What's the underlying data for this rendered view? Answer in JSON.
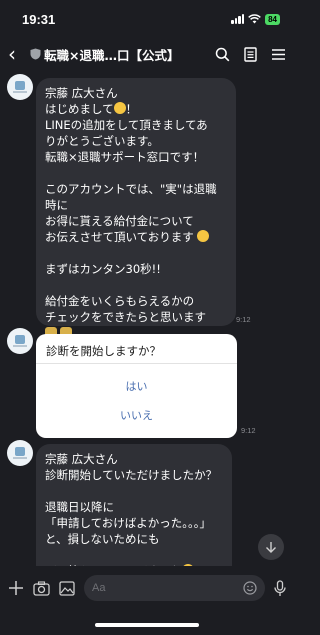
{
  "status_bar": {
    "time": "19:31",
    "battery": "84"
  },
  "header": {
    "title": "転職×退職…口【公式】",
    "back": "‹"
  },
  "messages": {
    "first": {
      "text": "宗藤 広大さん\nはじめまして",
      "text2": "！\nLINEの追加をして頂きましてあ\nりがとうございます。\n転職×退職サポート窓口です！\n\nこのアカウントでは、\"実\"は退職\n時に\nお得に貰える給付金について\nお伝えさせて頂いております",
      "text3": "\n\nまずはカンタン30秒!!\n\n給付金をいくらもらえるかの\nチェックをできたらと思います",
      "time": "9:12"
    },
    "card": {
      "question": "診断を開始しますか？",
      "option_yes": "はい",
      "option_no": "いいえ",
      "time": "9:12"
    },
    "third": {
      "text": "宗藤 広大さん\n診断開始していただけましたか？\n\n退職日以降に\n「申請しておけばよかった。。。」\nと、損しないためにも\n\nぜひ答えてみてくださいね"
    }
  },
  "input": {
    "placeholder": "Aa"
  },
  "icons": {
    "back": "chevron-left-icon",
    "search": "search-icon",
    "notes": "notes-icon",
    "menu": "menu-icon",
    "add": "plus-icon",
    "camera": "camera-icon",
    "image": "image-icon",
    "emoji": "emoji-icon",
    "mic": "microphone-icon",
    "scroll": "arrow-down-icon"
  },
  "colors": {
    "background": "#1c1d22",
    "bubble": "#2f3036",
    "link": "#4a6fb0",
    "battery": "#4cd964"
  }
}
